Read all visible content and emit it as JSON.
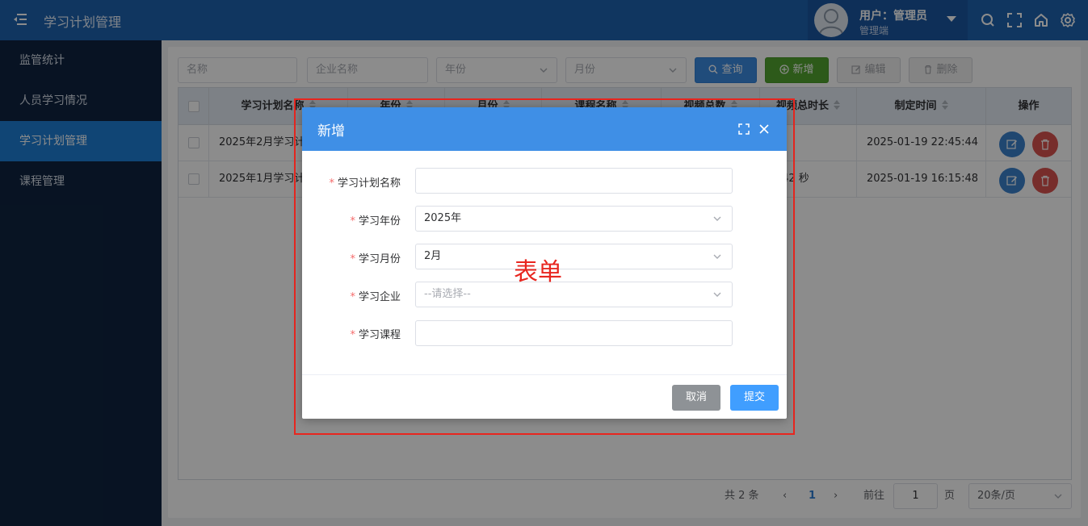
{
  "header": {
    "title": "学习计划管理",
    "user_label": "用户：管理员",
    "user_role": "管理端"
  },
  "sidebar": {
    "items": [
      {
        "label": "监管统计"
      },
      {
        "label": "人员学习情况"
      },
      {
        "label": "学习计划管理",
        "active": true
      },
      {
        "label": "课程管理"
      }
    ]
  },
  "filters": {
    "name_placeholder": "名称",
    "company_placeholder": "企业名称",
    "year_placeholder": "年份",
    "month_placeholder": "月份"
  },
  "toolbar": {
    "query": "查询",
    "add": "新增",
    "edit": "编辑",
    "delete": "删除"
  },
  "table": {
    "columns": [
      "学习计划名称",
      "年份",
      "月份",
      "课程名称",
      "视频总数",
      "视频总时长",
      "制定时间",
      "操作"
    ],
    "rows": [
      {
        "name": "2025年2月学习计划",
        "duration": "秒",
        "created": "2025-01-19 22:45:44"
      },
      {
        "name": "2025年1月学习计划",
        "duration": "分 42 秒",
        "created": "2025-01-19 16:15:48"
      }
    ]
  },
  "pagination": {
    "total": "共 2 条",
    "current_page": "1",
    "goto_label": "前往",
    "goto_value": "1",
    "page_unit": "页",
    "page_size": "20条/页"
  },
  "dialog": {
    "title": "新增",
    "fields": [
      {
        "label": "学习计划名称",
        "value": "",
        "type": "text"
      },
      {
        "label": "学习年份",
        "value": "2025年",
        "type": "select"
      },
      {
        "label": "学习月份",
        "value": "2月",
        "type": "select"
      },
      {
        "label": "学习企业",
        "value": "--请选择--",
        "type": "select",
        "placeholder": true
      },
      {
        "label": "学习课程",
        "value": "",
        "type": "text"
      }
    ],
    "required_mark": "*",
    "cancel": "取消",
    "submit": "提交"
  },
  "annotation": {
    "text": "表单",
    "color": "#e8261f"
  },
  "colors": {
    "topbar": "#1e63b0",
    "sidebar": "#0f2440",
    "sidebar_active": "#1e7fd6",
    "dialog_header": "#3f8fe6",
    "submit": "#409eff"
  }
}
